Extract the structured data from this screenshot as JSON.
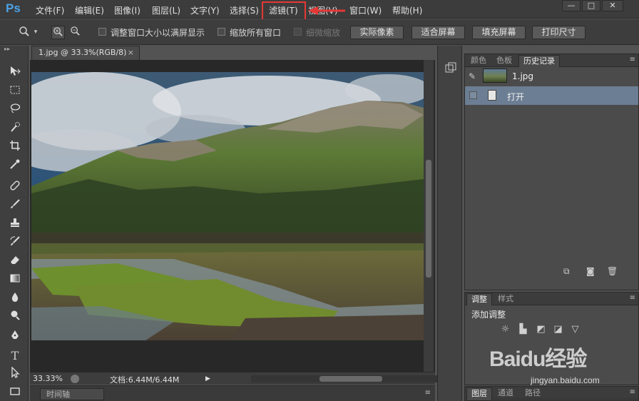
{
  "app": {
    "logo": "Ps"
  },
  "menu": [
    "文件(F)",
    "编辑(E)",
    "图像(I)",
    "图层(L)",
    "文字(Y)",
    "选择(S)",
    "滤镜(T)",
    "视图(V)",
    "窗口(W)",
    "帮助(H)"
  ],
  "window_controls": [
    "—",
    "□",
    "✕"
  ],
  "options": {
    "check1": "调整窗口大小以满屏显示",
    "check2": "缩放所有窗口",
    "check3": "细微缩放",
    "btn_actual": "实际像素",
    "btn_fit": "适合屏幕",
    "btn_fill": "填充屏幕",
    "btn_print": "打印尺寸"
  },
  "document": {
    "tab_title": "1.jpg @ 33.3%(RGB/8)",
    "tab_close": "×",
    "zoom": "33.33%",
    "doc_info": "文档:6.44M/6.44M"
  },
  "timeline": {
    "label": "时间轴"
  },
  "history_panel": {
    "tabs": [
      "颜色",
      "色板",
      "历史记录"
    ],
    "snapshot": "1.jpg",
    "entry": "打开"
  },
  "adjust_panel": {
    "tabs": [
      "调整",
      "样式"
    ],
    "title": "添加调整"
  },
  "layers_panel": {
    "tabs": [
      "图层",
      "通道",
      "路径"
    ]
  },
  "watermark": {
    "brand": "Baidu经验",
    "url": "jingyan.baidu.com"
  },
  "colors": {
    "accent_red": "#e53935",
    "history_selected": "#6c7e93",
    "ps_blue": "#4aa3e8"
  }
}
